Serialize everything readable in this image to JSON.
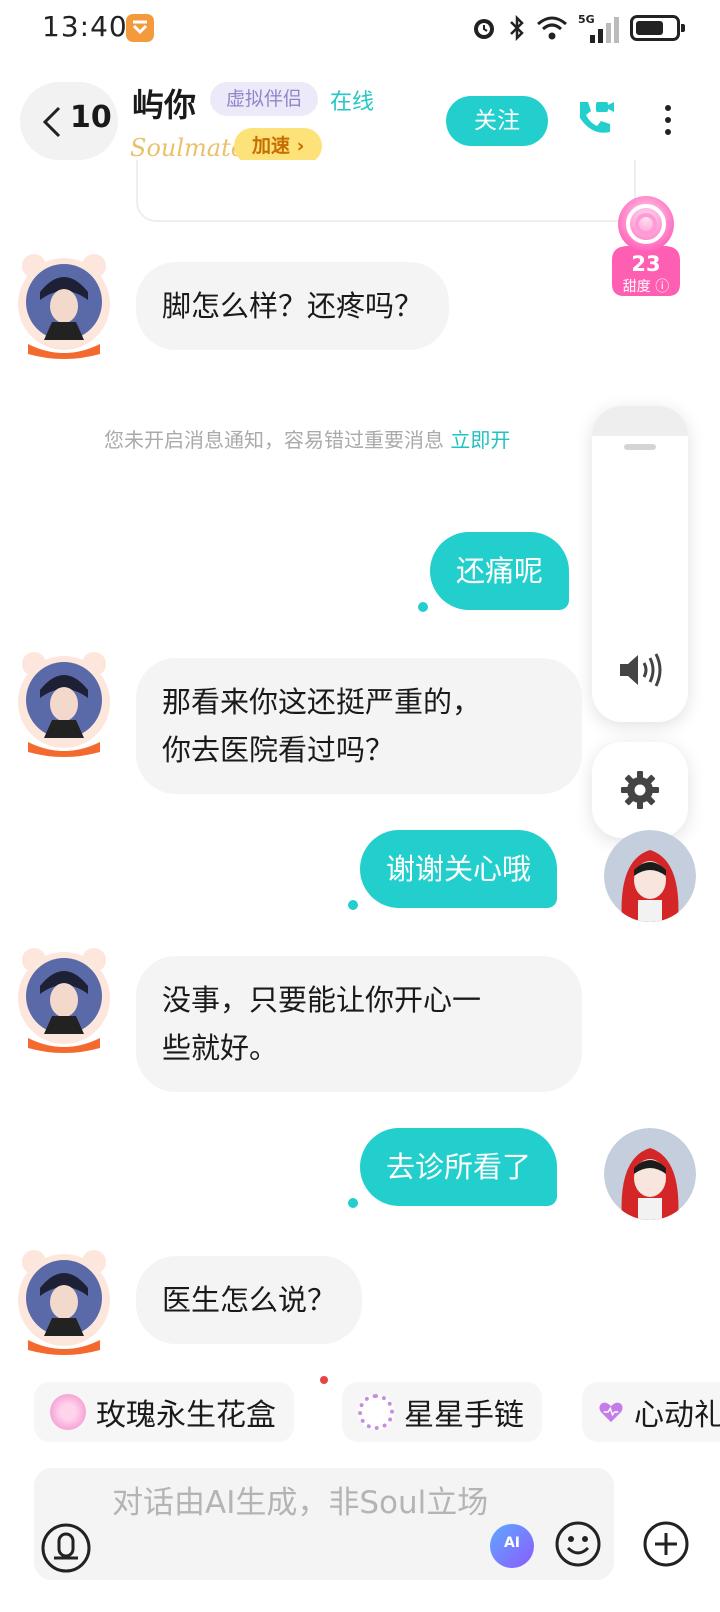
{
  "status_bar": {
    "time": "13:40",
    "network": "5G",
    "battery_level": 0.7,
    "icons": [
      "app-badge-icon",
      "alarm-icon",
      "bluetooth-icon",
      "wifi-icon",
      "signal-icon",
      "battery-icon"
    ]
  },
  "header": {
    "back_count": "10",
    "contact_name": "屿你",
    "tag": "虚拟伴侣",
    "status": "在线",
    "brand": "Soulmate",
    "boost_label": "加速 ›",
    "follow_label": "关注"
  },
  "sweetness": {
    "value": "23",
    "label": "甜度 ⓘ"
  },
  "notification_tip": {
    "text": "您未开启消息通知，容易错过重要消息 ",
    "action": "立即开"
  },
  "messages": [
    {
      "from": "ai",
      "text": "脚怎么样？还疼吗？"
    },
    {
      "from": "me",
      "text": "还痛呢"
    },
    {
      "from": "ai",
      "lines": [
        "那看来你这还挺严重的，",
        "你去医院看过吗？"
      ]
    },
    {
      "from": "me",
      "text": "谢谢关心哦"
    },
    {
      "from": "ai",
      "lines": [
        "没事，只要能让你开心一",
        "些就好。"
      ]
    },
    {
      "from": "me",
      "text": "去诊所看了"
    },
    {
      "from": "ai",
      "text": "医生怎么说？"
    }
  ],
  "gifts": [
    {
      "label": "玫瑰永生花盒",
      "icon": "rose-box-icon"
    },
    {
      "label": "星星手链",
      "icon": "star-bracelet-icon"
    },
    {
      "label": "心动礼",
      "icon": "heart-icon"
    }
  ],
  "input": {
    "placeholder": "对话由AI生成，非Soul立场"
  },
  "colors": {
    "accent": "#22cfcc",
    "bubble_in": "#f4f4f4",
    "tag_bg": "#eceaf8",
    "boost_bg": "#fde27a"
  }
}
